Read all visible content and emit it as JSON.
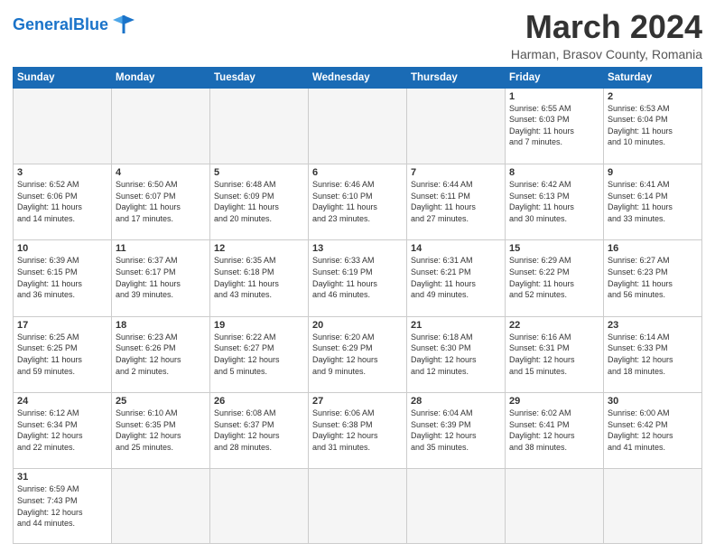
{
  "header": {
    "logo_general": "General",
    "logo_blue": "Blue",
    "month": "March 2024",
    "location": "Harman, Brasov County, Romania"
  },
  "weekdays": [
    "Sunday",
    "Monday",
    "Tuesday",
    "Wednesday",
    "Thursday",
    "Friday",
    "Saturday"
  ],
  "weeks": [
    [
      {
        "day": "",
        "info": "",
        "empty": true
      },
      {
        "day": "",
        "info": "",
        "empty": true
      },
      {
        "day": "",
        "info": "",
        "empty": true
      },
      {
        "day": "",
        "info": "",
        "empty": true
      },
      {
        "day": "",
        "info": "",
        "empty": true
      },
      {
        "day": "1",
        "info": "Sunrise: 6:55 AM\nSunset: 6:03 PM\nDaylight: 11 hours\nand 7 minutes."
      },
      {
        "day": "2",
        "info": "Sunrise: 6:53 AM\nSunset: 6:04 PM\nDaylight: 11 hours\nand 10 minutes."
      }
    ],
    [
      {
        "day": "3",
        "info": "Sunrise: 6:52 AM\nSunset: 6:06 PM\nDaylight: 11 hours\nand 14 minutes."
      },
      {
        "day": "4",
        "info": "Sunrise: 6:50 AM\nSunset: 6:07 PM\nDaylight: 11 hours\nand 17 minutes."
      },
      {
        "day": "5",
        "info": "Sunrise: 6:48 AM\nSunset: 6:09 PM\nDaylight: 11 hours\nand 20 minutes."
      },
      {
        "day": "6",
        "info": "Sunrise: 6:46 AM\nSunset: 6:10 PM\nDaylight: 11 hours\nand 23 minutes."
      },
      {
        "day": "7",
        "info": "Sunrise: 6:44 AM\nSunset: 6:11 PM\nDaylight: 11 hours\nand 27 minutes."
      },
      {
        "day": "8",
        "info": "Sunrise: 6:42 AM\nSunset: 6:13 PM\nDaylight: 11 hours\nand 30 minutes."
      },
      {
        "day": "9",
        "info": "Sunrise: 6:41 AM\nSunset: 6:14 PM\nDaylight: 11 hours\nand 33 minutes."
      }
    ],
    [
      {
        "day": "10",
        "info": "Sunrise: 6:39 AM\nSunset: 6:15 PM\nDaylight: 11 hours\nand 36 minutes."
      },
      {
        "day": "11",
        "info": "Sunrise: 6:37 AM\nSunset: 6:17 PM\nDaylight: 11 hours\nand 39 minutes."
      },
      {
        "day": "12",
        "info": "Sunrise: 6:35 AM\nSunset: 6:18 PM\nDaylight: 11 hours\nand 43 minutes."
      },
      {
        "day": "13",
        "info": "Sunrise: 6:33 AM\nSunset: 6:19 PM\nDaylight: 11 hours\nand 46 minutes."
      },
      {
        "day": "14",
        "info": "Sunrise: 6:31 AM\nSunset: 6:21 PM\nDaylight: 11 hours\nand 49 minutes."
      },
      {
        "day": "15",
        "info": "Sunrise: 6:29 AM\nSunset: 6:22 PM\nDaylight: 11 hours\nand 52 minutes."
      },
      {
        "day": "16",
        "info": "Sunrise: 6:27 AM\nSunset: 6:23 PM\nDaylight: 11 hours\nand 56 minutes."
      }
    ],
    [
      {
        "day": "17",
        "info": "Sunrise: 6:25 AM\nSunset: 6:25 PM\nDaylight: 11 hours\nand 59 minutes."
      },
      {
        "day": "18",
        "info": "Sunrise: 6:23 AM\nSunset: 6:26 PM\nDaylight: 12 hours\nand 2 minutes."
      },
      {
        "day": "19",
        "info": "Sunrise: 6:22 AM\nSunset: 6:27 PM\nDaylight: 12 hours\nand 5 minutes."
      },
      {
        "day": "20",
        "info": "Sunrise: 6:20 AM\nSunset: 6:29 PM\nDaylight: 12 hours\nand 9 minutes."
      },
      {
        "day": "21",
        "info": "Sunrise: 6:18 AM\nSunset: 6:30 PM\nDaylight: 12 hours\nand 12 minutes."
      },
      {
        "day": "22",
        "info": "Sunrise: 6:16 AM\nSunset: 6:31 PM\nDaylight: 12 hours\nand 15 minutes."
      },
      {
        "day": "23",
        "info": "Sunrise: 6:14 AM\nSunset: 6:33 PM\nDaylight: 12 hours\nand 18 minutes."
      }
    ],
    [
      {
        "day": "24",
        "info": "Sunrise: 6:12 AM\nSunset: 6:34 PM\nDaylight: 12 hours\nand 22 minutes."
      },
      {
        "day": "25",
        "info": "Sunrise: 6:10 AM\nSunset: 6:35 PM\nDaylight: 12 hours\nand 25 minutes."
      },
      {
        "day": "26",
        "info": "Sunrise: 6:08 AM\nSunset: 6:37 PM\nDaylight: 12 hours\nand 28 minutes."
      },
      {
        "day": "27",
        "info": "Sunrise: 6:06 AM\nSunset: 6:38 PM\nDaylight: 12 hours\nand 31 minutes."
      },
      {
        "day": "28",
        "info": "Sunrise: 6:04 AM\nSunset: 6:39 PM\nDaylight: 12 hours\nand 35 minutes."
      },
      {
        "day": "29",
        "info": "Sunrise: 6:02 AM\nSunset: 6:41 PM\nDaylight: 12 hours\nand 38 minutes."
      },
      {
        "day": "30",
        "info": "Sunrise: 6:00 AM\nSunset: 6:42 PM\nDaylight: 12 hours\nand 41 minutes."
      }
    ],
    [
      {
        "day": "31",
        "info": "Sunrise: 6:59 AM\nSunset: 7:43 PM\nDaylight: 12 hours\nand 44 minutes.",
        "last": true
      },
      {
        "day": "",
        "info": "",
        "empty": true,
        "last": true
      },
      {
        "day": "",
        "info": "",
        "empty": true,
        "last": true
      },
      {
        "day": "",
        "info": "",
        "empty": true,
        "last": true
      },
      {
        "day": "",
        "info": "",
        "empty": true,
        "last": true
      },
      {
        "day": "",
        "info": "",
        "empty": true,
        "last": true
      },
      {
        "day": "",
        "info": "",
        "empty": true,
        "last": true
      }
    ]
  ]
}
